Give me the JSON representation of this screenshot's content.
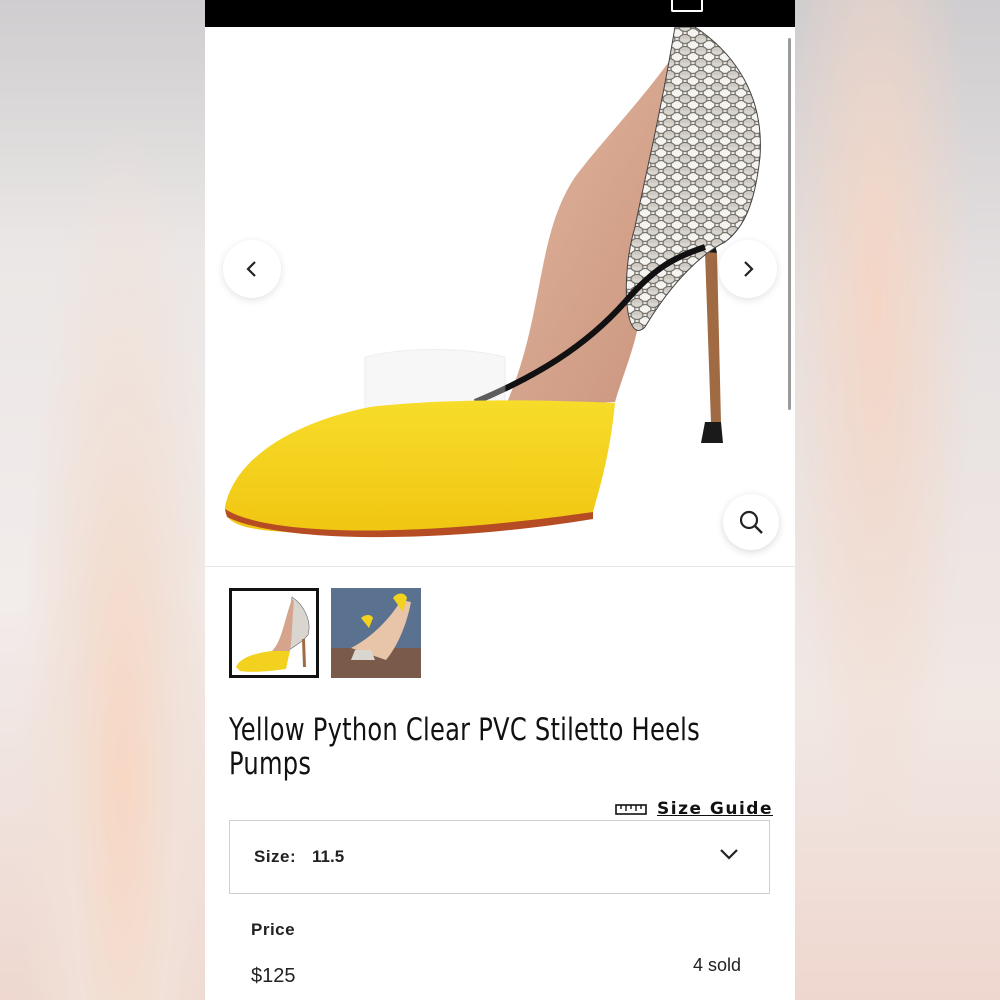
{
  "product": {
    "title": "Yellow Python Clear PVC Stiletto Heels Pumps",
    "price_label": "Price",
    "price": "$125",
    "sold": "4 sold"
  },
  "size_guide": {
    "label": "Size Guide"
  },
  "size_select": {
    "label": "Size:",
    "value": "11.5"
  },
  "gallery": {
    "thumbnail_count": 2,
    "active_index": 0
  },
  "icons": {
    "prev": "chevron-left-icon",
    "next": "chevron-right-icon",
    "zoom": "magnifier-icon",
    "size_guide": "ruler-icon",
    "dropdown": "chevron-down-icon",
    "cart": "cart-icon"
  },
  "colors": {
    "shoe_yellow": "#f2d21e",
    "topbar": "#000000",
    "text": "#111111"
  }
}
